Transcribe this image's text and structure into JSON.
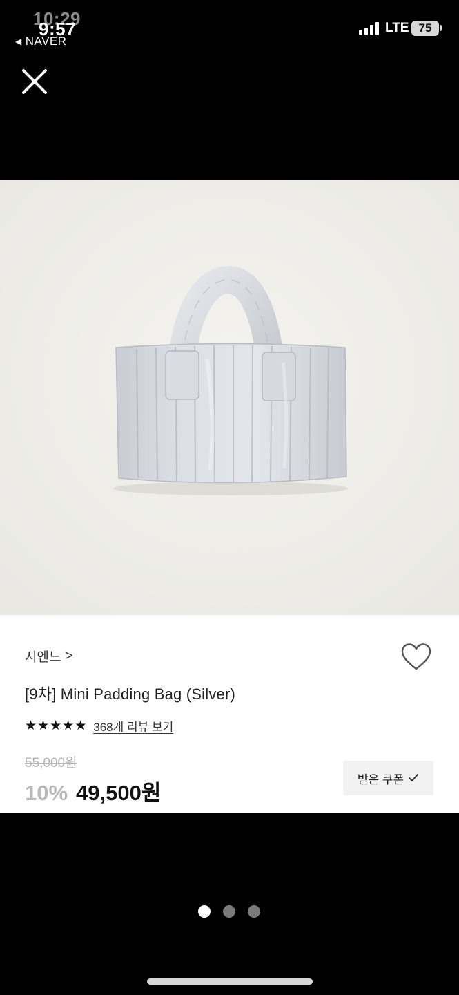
{
  "status_bar": {
    "time_ghost": "10:29",
    "time": "9:57",
    "back_app": "NAVER",
    "network": "LTE",
    "battery": "75"
  },
  "product": {
    "brand": "시엔느",
    "title": "[9차] Mini Padding Bag (Silver)",
    "rating_stars": 5,
    "review_link": "368개 리뷰 보기",
    "original_price": "55,000원",
    "discount": "10%",
    "sale_price": "49,500원",
    "coupon_label": "받은 쿠폰"
  },
  "image_pager": {
    "total": 3,
    "current": 1
  },
  "colors": {
    "background": "#000000",
    "panel": "#ffffff",
    "muted_price": "#b5b5b5",
    "active_dot": "#ffffff",
    "inactive_dot": "#7a7a7a"
  },
  "icons": [
    "close-icon",
    "chevron-right-icon",
    "heart-outline-icon",
    "star-icon",
    "checkmark-icon",
    "signal-icon",
    "battery-icon"
  ]
}
